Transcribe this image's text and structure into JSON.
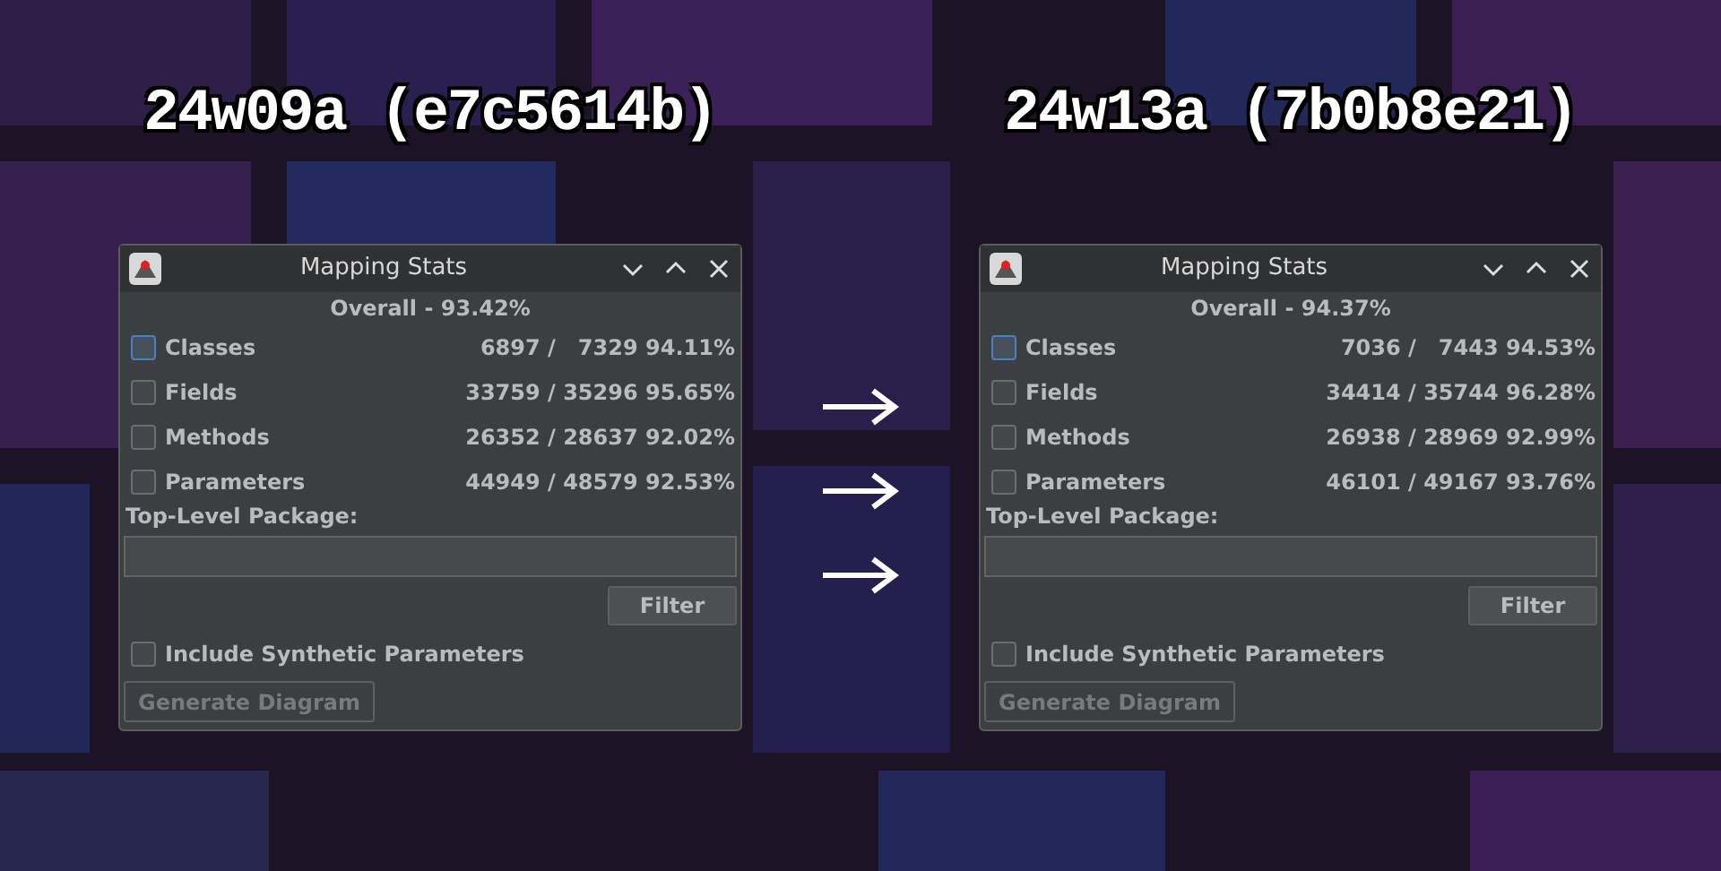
{
  "panels": [
    {
      "heading": "24w09a (e7c5614b)",
      "window": {
        "title": "Mapping Stats",
        "overall": "Overall - 93.42%",
        "stats": [
          {
            "label": "Classes",
            "value": "6897 /   7329 94.11%",
            "checked": false,
            "focused": true
          },
          {
            "label": "Fields",
            "value": "33759 / 35296 95.65%",
            "checked": false,
            "focused": false
          },
          {
            "label": "Methods",
            "value": "26352 / 28637 92.02%",
            "checked": false,
            "focused": false
          },
          {
            "label": "Parameters",
            "value": "44949 / 48579 92.53%",
            "checked": false,
            "focused": false
          }
        ],
        "package_label": "Top-Level Package:",
        "filter_button": "Filter",
        "synthetic": {
          "label": "Include Synthetic Parameters",
          "checked": false
        },
        "generate_button": {
          "label": "Generate Diagram",
          "disabled": true
        }
      }
    },
    {
      "heading": "24w13a (7b0b8e21)",
      "window": {
        "title": "Mapping Stats",
        "overall": "Overall - 94.37%",
        "stats": [
          {
            "label": "Classes",
            "value": "7036 /   7443 94.53%",
            "checked": false,
            "focused": true
          },
          {
            "label": "Fields",
            "value": "34414 / 35744 96.28%",
            "checked": false,
            "focused": false
          },
          {
            "label": "Methods",
            "value": "26938 / 28969 92.99%",
            "checked": false,
            "focused": false
          },
          {
            "label": "Parameters",
            "value": "46101 / 49167 93.76%",
            "checked": false,
            "focused": false
          }
        ],
        "package_label": "Top-Level Package:",
        "filter_button": "Filter",
        "synthetic": {
          "label": "Include Synthetic Parameters",
          "checked": false
        },
        "generate_button": {
          "label": "Generate Diagram",
          "disabled": true
        }
      }
    }
  ]
}
